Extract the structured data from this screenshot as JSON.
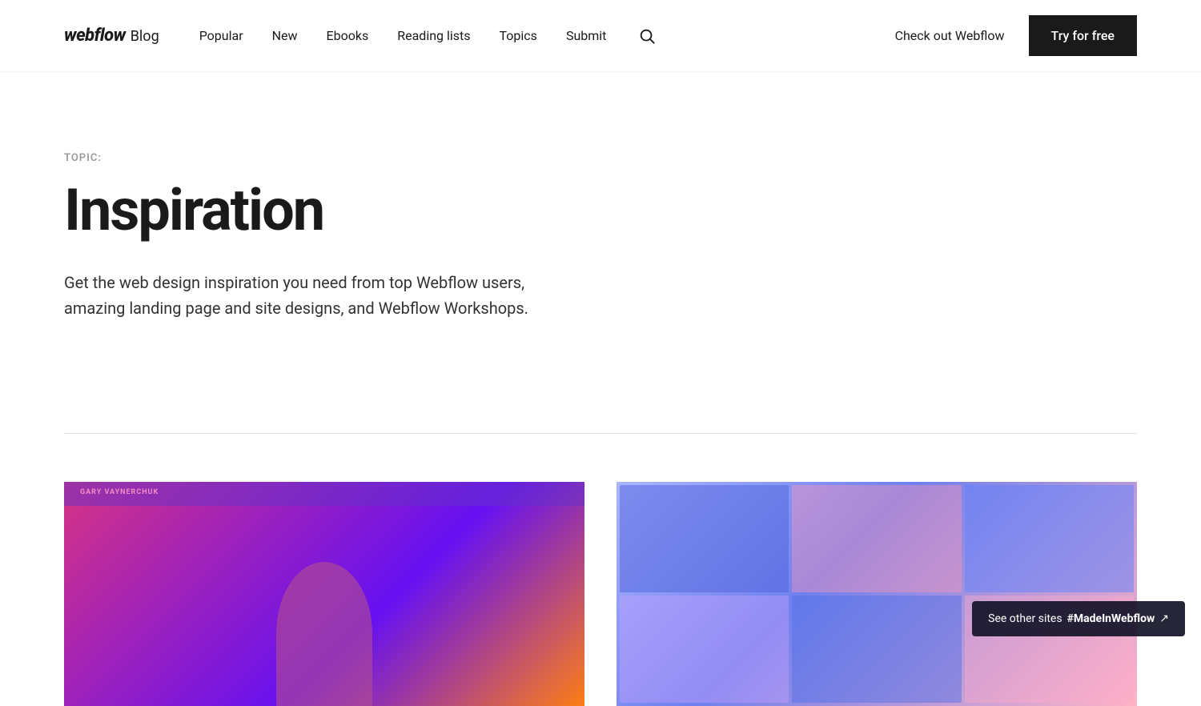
{
  "nav": {
    "logo_webflow": "webflow",
    "logo_blog": "Blog",
    "links": [
      {
        "id": "popular",
        "label": "Popular"
      },
      {
        "id": "new",
        "label": "New"
      },
      {
        "id": "ebooks",
        "label": "Ebooks"
      },
      {
        "id": "reading-lists",
        "label": "Reading lists"
      },
      {
        "id": "topics",
        "label": "Topics"
      },
      {
        "id": "submit",
        "label": "Submit"
      }
    ],
    "checkout_label": "Check out Webflow",
    "try_free_label": "Try for free"
  },
  "hero": {
    "topic_label": "TOPIC:",
    "title": "Inspiration",
    "description": "Get the web design inspiration you need from top Webflow users, amazing landing page and site designs, and Webflow Workshops."
  },
  "footer_banner": {
    "text": "See other sites ",
    "hashtag": "#MadeInWebflow"
  }
}
